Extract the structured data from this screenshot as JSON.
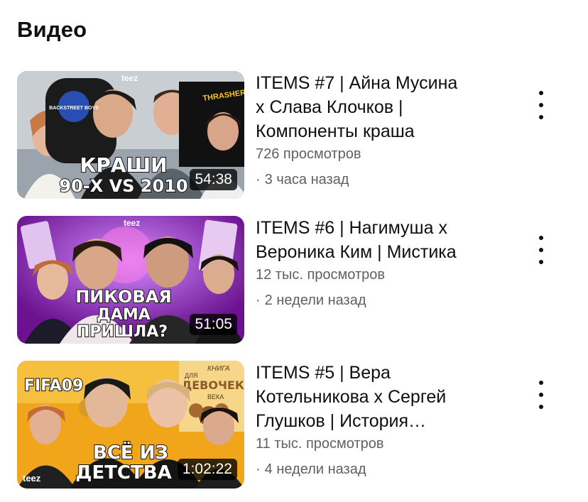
{
  "section": {
    "title": "Видео"
  },
  "videos": [
    {
      "title_lines": [
        "ITEMS #7 | Айна Мусина",
        "х Слава Клочков |",
        "Компоненты краша"
      ],
      "views": "726 просмотров",
      "age": "3 часа назад",
      "duration": "54:38",
      "thumb": {
        "brand": "teez",
        "caption_lines": [
          "КРАШИ",
          "90-Х VS 2010"
        ],
        "sign": "THRASHER",
        "tshirt": "BACKSTREET BOYS"
      }
    },
    {
      "title_lines": [
        "ITEMS #6 | Нагимуша х",
        "Вероника Ким | Мистика"
      ],
      "views": "12 тыс. просмотров",
      "age": "2 недели назад",
      "duration": "51:05",
      "thumb": {
        "brand": "teez",
        "caption_lines": [
          "ПИКОВАЯ",
          "ДАМА",
          "ПРИШЛА?"
        ]
      }
    },
    {
      "title_lines": [
        "ITEMS #5 | Вера",
        "Котельникова х Сергей",
        "Глушков | История…"
      ],
      "views": "11 тыс. просмотров",
      "age": "4 недели назад",
      "duration": "1:02:22",
      "thumb": {
        "brand": "teez",
        "caption_lines": [
          "ВСЁ ИЗ",
          "ДЕТСТВА"
        ],
        "book_lines": [
          "КНИГА",
          "ДЛЯ",
          "ДЕВОЧЕК",
          "ВЕКА"
        ],
        "game": "FIFA09"
      }
    }
  ],
  "colors": {
    "text_primary": "#0f0f0f",
    "text_secondary": "#606060",
    "thumb1_bg": "#9aa3ab",
    "thumb2_bg": "#8c1fb5",
    "thumb3_bg": "#f0a51a"
  }
}
